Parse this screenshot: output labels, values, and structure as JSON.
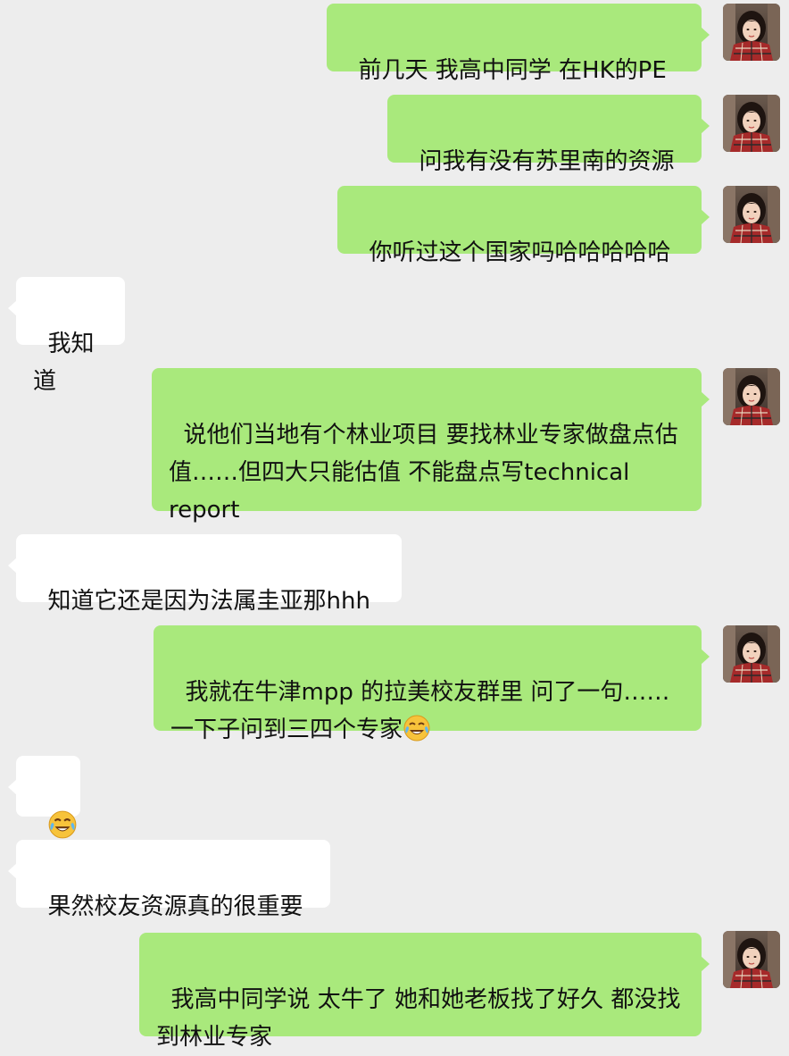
{
  "messages": [
    {
      "side": "out",
      "text": "前几天 我高中同学 在HK的PE"
    },
    {
      "side": "out",
      "text": "问我有没有苏里南的资源"
    },
    {
      "side": "out",
      "text": "你听过这个国家吗哈哈哈哈哈"
    },
    {
      "side": "in",
      "text": "我知道"
    },
    {
      "side": "out",
      "text": "说他们当地有个林业项目 要找林业专家做盘点估值……但四大只能估值 不能盘点写technical report"
    },
    {
      "side": "in",
      "text": "知道它还是因为法属圭亚那hhh"
    },
    {
      "side": "out",
      "text": "我就在牛津mpp 的拉美校友群里 问了一句……一下子问到三四个专家",
      "trailing_emoji": "laughing-crying-emoji"
    },
    {
      "side": "in",
      "text": "",
      "emoji_only": "laughing-crying-emoji"
    },
    {
      "side": "in",
      "text": "果然校友资源真的很重要"
    },
    {
      "side": "out",
      "text": "我高中同学说 太牛了 她和她老板找了好久 都没找到林业专家"
    }
  ],
  "colors": {
    "background": "#ededed",
    "outgoing_bubble": "#a9e97c",
    "incoming_bubble": "#ffffff",
    "text": "#111111"
  },
  "avatar": {
    "icon": "user-avatar"
  }
}
